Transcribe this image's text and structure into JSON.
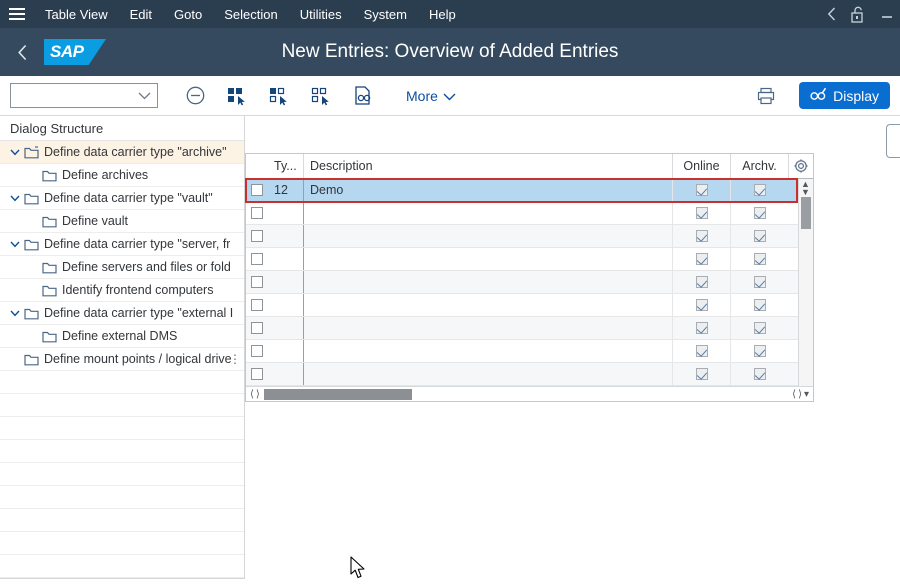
{
  "menubar": {
    "hamburger_icon": "hamburger-menu-icon",
    "items": [
      {
        "label": "Table View",
        "accel": "T"
      },
      {
        "label": "Edit",
        "accel": "E"
      },
      {
        "label": "Goto",
        "accel": "G"
      },
      {
        "label": "Selection",
        "accel": "l"
      },
      {
        "label": "Utilities",
        "accel": "s"
      },
      {
        "label": "System",
        "accel": "y"
      },
      {
        "label": "Help",
        "accel": "H"
      }
    ],
    "right_icons": [
      {
        "name": "back-chevron-icon"
      },
      {
        "name": "unlock-padlock-icon"
      },
      {
        "name": "minimize-icon"
      }
    ]
  },
  "titlebar": {
    "back_icon": "back-chevron-icon",
    "logo_text": "SAP",
    "title": "New Entries: Overview of Added Entries"
  },
  "toolbar": {
    "combo_value": "",
    "combo_placeholder": "",
    "combo_icon": "chevron-down-icon",
    "buttons": [
      {
        "name": "delete-row-button",
        "icon": "circle-minus-icon"
      },
      {
        "name": "select-all-button",
        "icon": "select-all-blocks-icon"
      },
      {
        "name": "select-block-button",
        "icon": "select-block-icon"
      },
      {
        "name": "deselect-all-button",
        "icon": "deselect-all-blocks-icon"
      },
      {
        "name": "variant-button",
        "icon": "document-glasses-icon"
      }
    ],
    "more_label": "More",
    "more_icon": "chevron-down-icon",
    "print_icon": "printer-icon",
    "display_label": "Display",
    "display_icon": "glasses-pencil-icon",
    "accent_color": "#0a6ed1"
  },
  "sidebar": {
    "header": "Dialog Structure",
    "tree": [
      {
        "label": "Define data carrier type \"archive\"",
        "level": 0,
        "expandable": true,
        "selected": true,
        "icon": "folder-open-icon"
      },
      {
        "label": "Define archives",
        "level": 1,
        "expandable": false,
        "selected": false,
        "icon": "folder-icon"
      },
      {
        "label": "Define data carrier type \"vault\"",
        "level": 0,
        "expandable": true,
        "selected": false,
        "icon": "folder-icon"
      },
      {
        "label": "Define vault",
        "level": 1,
        "expandable": false,
        "selected": false,
        "icon": "folder-icon"
      },
      {
        "label": "Define data carrier type \"server, fr",
        "level": 0,
        "expandable": true,
        "selected": false,
        "icon": "folder-icon"
      },
      {
        "label": "Define servers and files or fold",
        "level": 1,
        "expandable": false,
        "selected": false,
        "icon": "folder-icon"
      },
      {
        "label": "Identify frontend computers",
        "level": 1,
        "expandable": false,
        "selected": false,
        "icon": "folder-icon"
      },
      {
        "label": "Define data carrier type \"external I",
        "level": 0,
        "expandable": true,
        "selected": false,
        "icon": "folder-icon"
      },
      {
        "label": "Define external DMS",
        "level": 1,
        "expandable": false,
        "selected": false,
        "icon": "folder-icon"
      },
      {
        "label": "Define mount points / logical drive",
        "level": 0,
        "expandable": false,
        "selected": false,
        "icon": "folder-icon",
        "overflow_dots": "⋮"
      }
    ],
    "empty_row_count": 9
  },
  "table": {
    "columns": [
      {
        "key": "sel",
        "label": ""
      },
      {
        "key": "ty",
        "label": "Ty..."
      },
      {
        "key": "desc",
        "label": "Description"
      },
      {
        "key": "online",
        "label": "Online"
      },
      {
        "key": "archv",
        "label": "Archv."
      }
    ],
    "settings_icon": "gear-icon",
    "rows": [
      {
        "selected": false,
        "ty": "12",
        "desc": "Demo",
        "online": true,
        "archv": true,
        "highlighted": true
      },
      {
        "selected": false,
        "ty": "",
        "desc": "",
        "online": true,
        "archv": true,
        "highlighted": false
      },
      {
        "selected": false,
        "ty": "",
        "desc": "",
        "online": true,
        "archv": true,
        "highlighted": false
      },
      {
        "selected": false,
        "ty": "",
        "desc": "",
        "online": true,
        "archv": true,
        "highlighted": false
      },
      {
        "selected": false,
        "ty": "",
        "desc": "",
        "online": true,
        "archv": true,
        "highlighted": false
      },
      {
        "selected": false,
        "ty": "",
        "desc": "",
        "online": true,
        "archv": true,
        "highlighted": false
      },
      {
        "selected": false,
        "ty": "",
        "desc": "",
        "online": true,
        "archv": true,
        "highlighted": false
      },
      {
        "selected": false,
        "ty": "",
        "desc": "",
        "online": true,
        "archv": true,
        "highlighted": false
      },
      {
        "selected": false,
        "ty": "",
        "desc": "",
        "online": true,
        "archv": true,
        "highlighted": false
      }
    ],
    "highlight_color": "#c9302c",
    "selected_row_color": "#b5d7f0"
  }
}
